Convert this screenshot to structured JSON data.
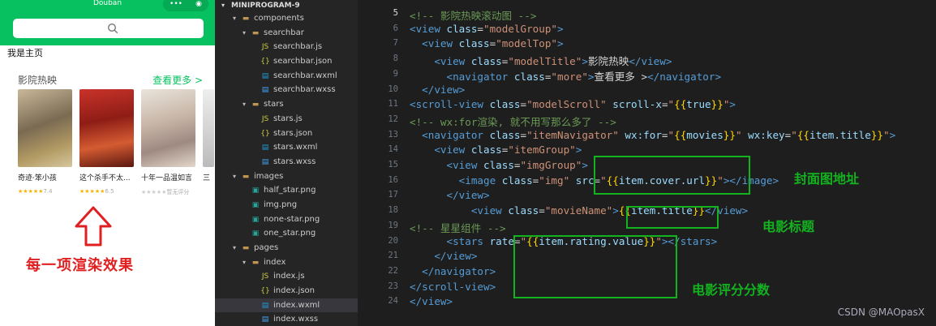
{
  "phone": {
    "nav_title": "Douban",
    "capsule_dots": "•••",
    "capsule_close": "◉",
    "home_label": "我是主页",
    "section_title": "影院热映",
    "more_label": "查看更多 >",
    "movies": [
      {
        "title": "奇迹·笨小孩",
        "rating": "7.4",
        "stars": "★★★★★"
      },
      {
        "title": "这个杀手不太...",
        "rating": "6.5",
        "stars": "★★★★★"
      },
      {
        "title": "十年一品温如言",
        "rating": "暂无评分",
        "stars": "★★★★★"
      },
      {
        "title": "三",
        "rating": "",
        "stars": ""
      }
    ],
    "caption": "每一项渲染效果"
  },
  "explorer": {
    "project": "MINIPROGRAM-9",
    "items": [
      {
        "label": "components",
        "kind": "folder",
        "depth": 1,
        "open": true
      },
      {
        "label": "searchbar",
        "kind": "folder",
        "depth": 2,
        "open": true
      },
      {
        "label": "searchbar.js",
        "kind": "js",
        "depth": 3
      },
      {
        "label": "searchbar.json",
        "kind": "json",
        "depth": 3
      },
      {
        "label": "searchbar.wxml",
        "kind": "wxml",
        "depth": 3
      },
      {
        "label": "searchbar.wxss",
        "kind": "wxss",
        "depth": 3
      },
      {
        "label": "stars",
        "kind": "folder",
        "depth": 2,
        "open": true
      },
      {
        "label": "stars.js",
        "kind": "js",
        "depth": 3
      },
      {
        "label": "stars.json",
        "kind": "json",
        "depth": 3
      },
      {
        "label": "stars.wxml",
        "kind": "wxml",
        "depth": 3
      },
      {
        "label": "stars.wxss",
        "kind": "wxss",
        "depth": 3
      },
      {
        "label": "images",
        "kind": "folder",
        "depth": 1,
        "open": true
      },
      {
        "label": "half_star.png",
        "kind": "png",
        "depth": 2
      },
      {
        "label": "img.png",
        "kind": "png",
        "depth": 2
      },
      {
        "label": "none-star.png",
        "kind": "png",
        "depth": 2
      },
      {
        "label": "one_star.png",
        "kind": "png",
        "depth": 2
      },
      {
        "label": "pages",
        "kind": "folder",
        "depth": 1,
        "open": true
      },
      {
        "label": "index",
        "kind": "folder",
        "depth": 2,
        "open": true
      },
      {
        "label": "index.js",
        "kind": "js",
        "depth": 3
      },
      {
        "label": "index.json",
        "kind": "json",
        "depth": 3
      },
      {
        "label": "index.wxml",
        "kind": "wxml",
        "depth": 3,
        "selected": true
      },
      {
        "label": "index.wxss",
        "kind": "wxss",
        "depth": 3
      }
    ]
  },
  "editor": {
    "lines": [
      {
        "n": "5",
        "cur": true,
        "parts": [
          [
            "cm",
            "<!-- 影院热映滚动图 -->"
          ]
        ]
      },
      {
        "n": "6",
        "parts": [
          [
            "tg",
            "<view "
          ],
          [
            "at",
            "class"
          ],
          [
            "tx",
            "="
          ],
          [
            "st",
            "\"modelGroup\""
          ],
          [
            "tg",
            ">"
          ]
        ]
      },
      {
        "n": "7",
        "parts": [
          [
            "tx",
            "  "
          ],
          [
            "tg",
            "<view "
          ],
          [
            "at",
            "class"
          ],
          [
            "tx",
            "="
          ],
          [
            "st",
            "\"modelTop\""
          ],
          [
            "tg",
            ">"
          ]
        ]
      },
      {
        "n": "8",
        "parts": [
          [
            "tx",
            "    "
          ],
          [
            "tg",
            "<view "
          ],
          [
            "at",
            "class"
          ],
          [
            "tx",
            "="
          ],
          [
            "st",
            "\"modelTitle\""
          ],
          [
            "tg",
            ">"
          ],
          [
            "tx",
            "影院热映"
          ],
          [
            "tg",
            "</view>"
          ]
        ]
      },
      {
        "n": "9",
        "parts": [
          [
            "tx",
            "      "
          ],
          [
            "tg",
            "<navigator "
          ],
          [
            "at",
            "class"
          ],
          [
            "tx",
            "="
          ],
          [
            "st",
            "\"more\""
          ],
          [
            "tg",
            ">"
          ],
          [
            "tx",
            "查看更多 >"
          ],
          [
            "tg",
            "</navigator>"
          ]
        ]
      },
      {
        "n": "10",
        "parts": [
          [
            "tx",
            "  "
          ],
          [
            "tg",
            "</view>"
          ]
        ]
      },
      {
        "n": "11",
        "parts": [
          [
            "tg",
            "<scroll-view "
          ],
          [
            "at",
            "class"
          ],
          [
            "tx",
            "="
          ],
          [
            "st",
            "\"modelScroll\""
          ],
          [
            "tx",
            " "
          ],
          [
            "at",
            "scroll-x"
          ],
          [
            "tx",
            "="
          ],
          [
            "st",
            "\""
          ],
          [
            "br",
            "{{"
          ],
          [
            "mu",
            "true"
          ],
          [
            "br",
            "}}"
          ],
          [
            "st",
            "\""
          ],
          [
            "tg",
            ">"
          ]
        ]
      },
      {
        "n": "12",
        "parts": [
          [
            "cm",
            "<!-- wx:for渲染, 就不用写那么多了 -->"
          ]
        ]
      },
      {
        "n": "13",
        "parts": [
          [
            "tx",
            "  "
          ],
          [
            "tg",
            "<navigator "
          ],
          [
            "at",
            "class"
          ],
          [
            "tx",
            "="
          ],
          [
            "st",
            "\"itemNavigator\""
          ],
          [
            "tx",
            " "
          ],
          [
            "at",
            "wx:for"
          ],
          [
            "tx",
            "="
          ],
          [
            "st",
            "\""
          ],
          [
            "br",
            "{{"
          ],
          [
            "mu",
            "movies"
          ],
          [
            "br",
            "}}"
          ],
          [
            "st",
            "\""
          ],
          [
            "tx",
            " "
          ],
          [
            "at",
            "wx:key"
          ],
          [
            "tx",
            "="
          ],
          [
            "st",
            "\""
          ],
          [
            "br",
            "{{"
          ],
          [
            "mu",
            "item.title"
          ],
          [
            "br",
            "}}"
          ],
          [
            "st",
            "\""
          ],
          [
            "tg",
            ">"
          ]
        ]
      },
      {
        "n": "14",
        "parts": [
          [
            "tx",
            "    "
          ],
          [
            "tg",
            "<view "
          ],
          [
            "at",
            "class"
          ],
          [
            "tx",
            "="
          ],
          [
            "st",
            "\"itemGroup\""
          ],
          [
            "tg",
            ">"
          ]
        ]
      },
      {
        "n": "15",
        "parts": [
          [
            "tx",
            "      "
          ],
          [
            "tg",
            "<view "
          ],
          [
            "at",
            "class"
          ],
          [
            "tx",
            "="
          ],
          [
            "st",
            "\"imgGroup\""
          ],
          [
            "tg",
            ">"
          ]
        ]
      },
      {
        "n": "16",
        "parts": [
          [
            "tx",
            "        "
          ],
          [
            "tg",
            "<image "
          ],
          [
            "at",
            "class"
          ],
          [
            "tx",
            "="
          ],
          [
            "st",
            "\"img\""
          ],
          [
            "tx",
            " "
          ],
          [
            "at",
            "src"
          ],
          [
            "tx",
            "="
          ],
          [
            "st",
            "\""
          ],
          [
            "br",
            "{{"
          ],
          [
            "mu",
            "item.cover.url"
          ],
          [
            "br",
            "}}"
          ],
          [
            "st",
            "\""
          ],
          [
            "tg",
            ">"
          ],
          [
            "tg",
            "</image>"
          ]
        ]
      },
      {
        "n": "17",
        "parts": [
          [
            "tx",
            "      "
          ],
          [
            "tg",
            "</view>"
          ]
        ]
      },
      {
        "n": "18",
        "parts": [
          [
            "tx",
            "          "
          ],
          [
            "tg",
            "<view "
          ],
          [
            "at",
            "class"
          ],
          [
            "tx",
            "="
          ],
          [
            "st",
            "\"movieName\""
          ],
          [
            "tg",
            ">"
          ],
          [
            "br",
            "{{"
          ],
          [
            "mu",
            "item.title"
          ],
          [
            "br",
            "}}"
          ],
          [
            "tg",
            "</view>"
          ]
        ]
      },
      {
        "n": "19",
        "parts": [
          [
            "cm",
            "<!-- 星星组件 -->"
          ]
        ]
      },
      {
        "n": "20",
        "parts": [
          [
            "tx",
            "      "
          ],
          [
            "tg",
            "<stars "
          ],
          [
            "at",
            "rate"
          ],
          [
            "tx",
            "="
          ],
          [
            "st",
            "\""
          ],
          [
            "br",
            "{{"
          ],
          [
            "mu",
            "item.rating.value"
          ],
          [
            "br",
            "}}"
          ],
          [
            "st",
            "\""
          ],
          [
            "tg",
            ">"
          ],
          [
            "tg",
            "</stars>"
          ]
        ]
      },
      {
        "n": "21",
        "parts": [
          [
            "tx",
            "    "
          ],
          [
            "tg",
            "</view>"
          ]
        ]
      },
      {
        "n": "22",
        "parts": [
          [
            "tx",
            "  "
          ],
          [
            "tg",
            "</navigator>"
          ]
        ]
      },
      {
        "n": "23",
        "parts": [
          [
            "tg",
            "</scroll-view>"
          ]
        ]
      },
      {
        "n": "24",
        "parts": [
          [
            "tg",
            "</view>"
          ]
        ]
      }
    ],
    "annotations": {
      "cover": "封面图地址",
      "title": "电影标题",
      "rating": "电影评分分数"
    }
  },
  "watermark": "CSDN @MAOpasX",
  "colors": {
    "accent": "#07c160",
    "annotation": "#13b21f",
    "caption": "#e02020"
  }
}
